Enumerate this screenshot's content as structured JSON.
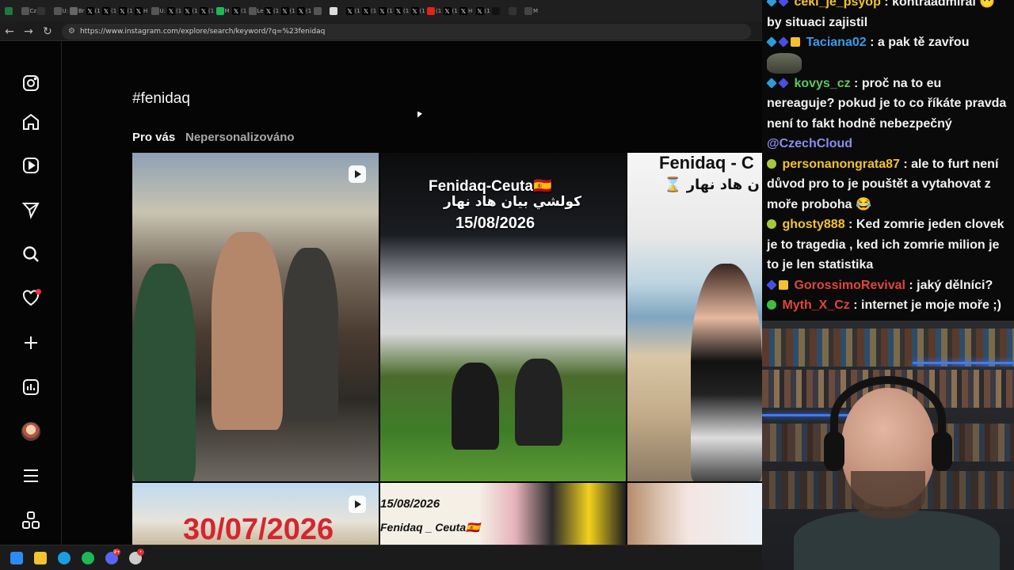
{
  "browser": {
    "tabs": [
      {
        "icon": "excel-icon",
        "label": "",
        "color": "#1f7a3f"
      },
      {
        "icon": "page-icon",
        "label": "Cz",
        "color": "#555"
      },
      {
        "icon": "page-icon",
        "label": "",
        "color": "#333"
      },
      {
        "icon": "page-icon",
        "label": "U:",
        "color": "#555"
      },
      {
        "icon": "globe-icon",
        "label": "Br",
        "color": "#666"
      },
      {
        "icon": "x-icon",
        "label": "(1",
        "color": "#000"
      },
      {
        "icon": "x-icon",
        "label": "(1",
        "color": "#000"
      },
      {
        "icon": "x-icon",
        "label": "(1",
        "color": "#000"
      },
      {
        "icon": "x-icon",
        "label": "H",
        "color": "#000"
      },
      {
        "icon": "page-icon",
        "label": "U:",
        "color": "#555"
      },
      {
        "icon": "x-icon",
        "label": "(1",
        "color": "#000"
      },
      {
        "icon": "x-icon",
        "label": "(1",
        "color": "#000"
      },
      {
        "icon": "x-icon",
        "label": "(1",
        "color": "#000"
      },
      {
        "icon": "m-icon",
        "label": "M",
        "color": "#1db954"
      },
      {
        "icon": "x-icon",
        "label": "(1",
        "color": "#000"
      },
      {
        "icon": "page-icon",
        "label": "Le",
        "color": "#555"
      },
      {
        "icon": "x-icon",
        "label": "(1",
        "color": "#000"
      },
      {
        "icon": "x-icon",
        "label": "(1",
        "color": "#000"
      },
      {
        "icon": "x-icon",
        "label": "(1",
        "color": "#000"
      },
      {
        "icon": "page-icon",
        "label": "",
        "color": "#555"
      },
      {
        "icon": "page-icon",
        "label": "",
        "color": "#ddd"
      },
      {
        "icon": "x-icon",
        "label": "(1",
        "color": "#000"
      },
      {
        "icon": "x-icon",
        "label": "(1",
        "color": "#000"
      },
      {
        "icon": "x-icon",
        "label": "(1",
        "color": "#000"
      },
      {
        "icon": "x-icon",
        "label": "(1",
        "color": "#000"
      },
      {
        "icon": "x-icon",
        "label": "(1",
        "color": "#000"
      },
      {
        "icon": "youtube-icon",
        "label": "(1",
        "color": "#e62117"
      },
      {
        "icon": "x-icon",
        "label": "(1",
        "color": "#000"
      },
      {
        "icon": "x-icon",
        "label": "H",
        "color": "#000"
      },
      {
        "icon": "x-icon",
        "label": "(1",
        "color": "#000"
      },
      {
        "icon": "tiktok-icon",
        "label": "",
        "color": "#111"
      },
      {
        "icon": "search-icon",
        "label": "",
        "color": "#333"
      },
      {
        "icon": "page-icon",
        "label": "M",
        "color": "#444"
      }
    ],
    "url": "https://www.instagram.com/explore/search/keyword/?q=%23fenidaq"
  },
  "instagram": {
    "hashtag": "#fenidaq",
    "tab_for_you": "Pro vás",
    "tab_unpersonalized": "Nepersonalizováno",
    "posts": {
      "p2_title": "Fenidaq-Ceuta🇪🇸",
      "p2_arabic": "كولشي بيان هاد نهار",
      "p2_date": "15/08/2026",
      "p3_title": "Fenidaq - C",
      "p3_arabic": "⌛ ن هاد نهار",
      "p4_date": "30/07/2026",
      "p5_date": "15/08/2026",
      "p5_title": "Fenidaq _ Ceuta🇪🇸"
    }
  },
  "chat": {
    "messages": [
      {
        "user": "ceki_je_psyop",
        "user_color": "#f2c230",
        "badges": [
          "blue",
          "indigo"
        ],
        "text": "kontraadmirál 😶 by situaci zajistil",
        "emote": false
      },
      {
        "user": "Taciana02",
        "user_color": "#3d9be9",
        "badges": [
          "blue",
          "indigo",
          "gold"
        ],
        "text": "a pak tě zavřou",
        "emote": true
      },
      {
        "user": "kovys_cz",
        "user_color": "#5ec75e",
        "badges": [
          "blue",
          "indigo"
        ],
        "text": "proč na to eu nereaguje? pokud je to co říkáte pravda není to fakt hodně nebezpečný",
        "mention": "@CzechCloud"
      },
      {
        "user": "personanongrata87",
        "user_color": "#f2c230",
        "badges": [
          "lime"
        ],
        "text": "ale to furt není důvod pro to je pouštět a vytahovat z moře proboha 😂"
      },
      {
        "user": "ghosty888",
        "user_color": "#f2c230",
        "badges": [
          "lime"
        ],
        "text": "Ked zomrie jeden clovek je to tragedia , ked ich zomrie milion je to je len statistika"
      },
      {
        "user": "GorossimoRevival",
        "user_color": "#e0463c",
        "badges": [
          "indigo",
          "gold"
        ],
        "text": "jaký dělníci?"
      },
      {
        "user": "Myth_X_Cz",
        "user_color": "#e0463c",
        "badges": [
          "green"
        ],
        "text": "internet je moje moře ;)"
      }
    ]
  },
  "taskbar": {
    "items": [
      {
        "name": "windows-start-icon",
        "color": "#2b8cf5",
        "badge": ""
      },
      {
        "name": "file-explorer-icon",
        "color": "#f2c230",
        "badge": ""
      },
      {
        "name": "edge-icon",
        "color": "#1b9de2",
        "badge": ""
      },
      {
        "name": "spotify-icon",
        "color": "#1db954",
        "badge": ""
      },
      {
        "name": "discord-icon",
        "color": "#5865f2",
        "badge": "9+"
      },
      {
        "name": "app-icon",
        "color": "#cccccc",
        "badge": "•"
      }
    ]
  }
}
